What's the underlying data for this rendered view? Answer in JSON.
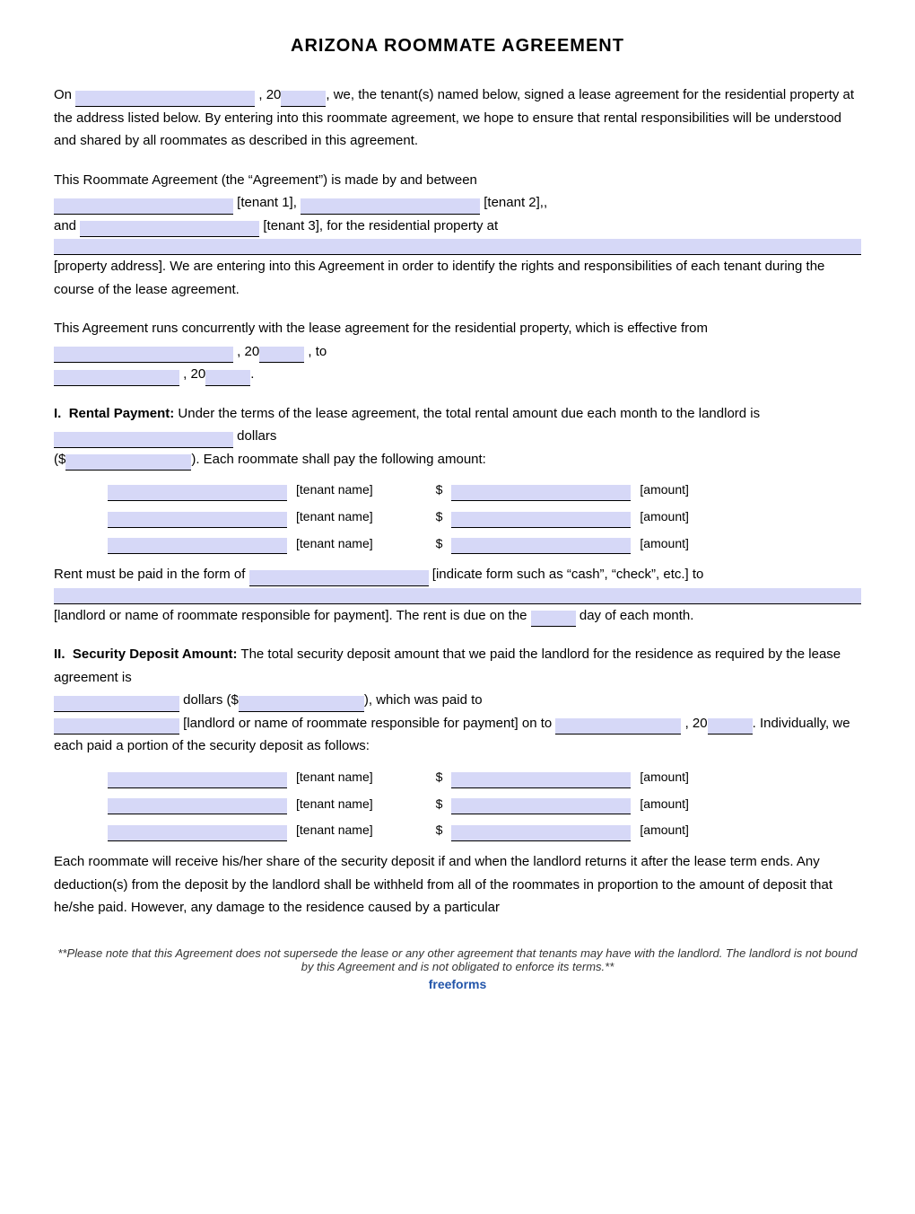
{
  "title": "ARIZONA ROOMMATE AGREEMENT",
  "para1": {
    "text_a": "On",
    "text_b": ", 20",
    "text_c": ", we, the tenant(s) named below, signed a lease agreement for the residential property at the address listed below. By entering into this roommate agreement, we hope to ensure that rental responsibilities will be understood and shared by all roommates as described in this agreement."
  },
  "para2": {
    "text_a": "This Roommate Agreement (the “Agreement”) is made by and between",
    "tenant1_label": "[tenant 1],",
    "tenant2_label": "[tenant 2],,",
    "and_text": "and",
    "tenant3_label": "[tenant 3], for the residential property at",
    "property_label": "[property address]. We are entering into this Agreement in order to identify the rights and responsibilities of each tenant during the course of the lease agreement."
  },
  "para3": {
    "text_a": "This Agreement runs concurrently with the lease agreement for the residential property, which is effective from",
    "text_b": ", 20",
    "text_c": ", to",
    "text_d": ", 20",
    "text_e": "."
  },
  "section1": {
    "heading": "I.",
    "heading2": "Rental Payment:",
    "text_a": "Under the terms of the lease agreement, the total rental amount due each month to the landlord is",
    "text_b": "dollars",
    "text_c": "($",
    "text_d": ").  Each roommate shall pay the following amount:",
    "tenants": [
      {
        "name_label": "[tenant name]",
        "dollar": "$",
        "amount_label": "[amount]"
      },
      {
        "name_label": "[tenant name]",
        "dollar": "$",
        "amount_label": "[amount]"
      },
      {
        "name_label": "[tenant name]",
        "dollar": "$",
        "amount_label": "[amount]"
      }
    ],
    "text_e": "Rent must be paid in the form of",
    "text_f": "[indicate form such as “cash”, “check”, etc.] to",
    "text_g": "[landlord or name of roommate responsible for payment]. The rent is due on the",
    "text_h": "day of each month."
  },
  "section2": {
    "heading": "II.",
    "heading2": "Security Deposit Amount:",
    "text_a": "The total security deposit amount that we paid the landlord for the residence as required by the lease agreement is",
    "text_b": "dollars ($",
    "text_c": "), which was paid to",
    "text_d": "[landlord or name of roommate responsible for payment] on to",
    "text_e": ", 20",
    "text_f": ".  Individually, we each paid a portion of the security deposit as follows:",
    "tenants": [
      {
        "name_label": "[tenant name]",
        "dollar": "$",
        "amount_label": "[amount]"
      },
      {
        "name_label": "[tenant name]",
        "dollar": "$",
        "amount_label": "[amount]"
      },
      {
        "name_label": "[tenant name]",
        "dollar": "$",
        "amount_label": "[amount]"
      }
    ],
    "text_g": "Each roommate will receive his/her share of the security deposit if and when the landlord returns it after the lease term ends. Any deduction(s) from the deposit by the landlord shall be withheld from all of the roommates in proportion to the amount of deposit that he/she paid. However, any damage to the residence caused by a particular"
  },
  "footer": {
    "note": "**Please note that this Agreement does not supersede the lease or any other agreement that tenants may have with the landlord. The landlord is not bound by this Agreement and is not obligated to enforce its terms.**",
    "brand": "freeforms"
  }
}
